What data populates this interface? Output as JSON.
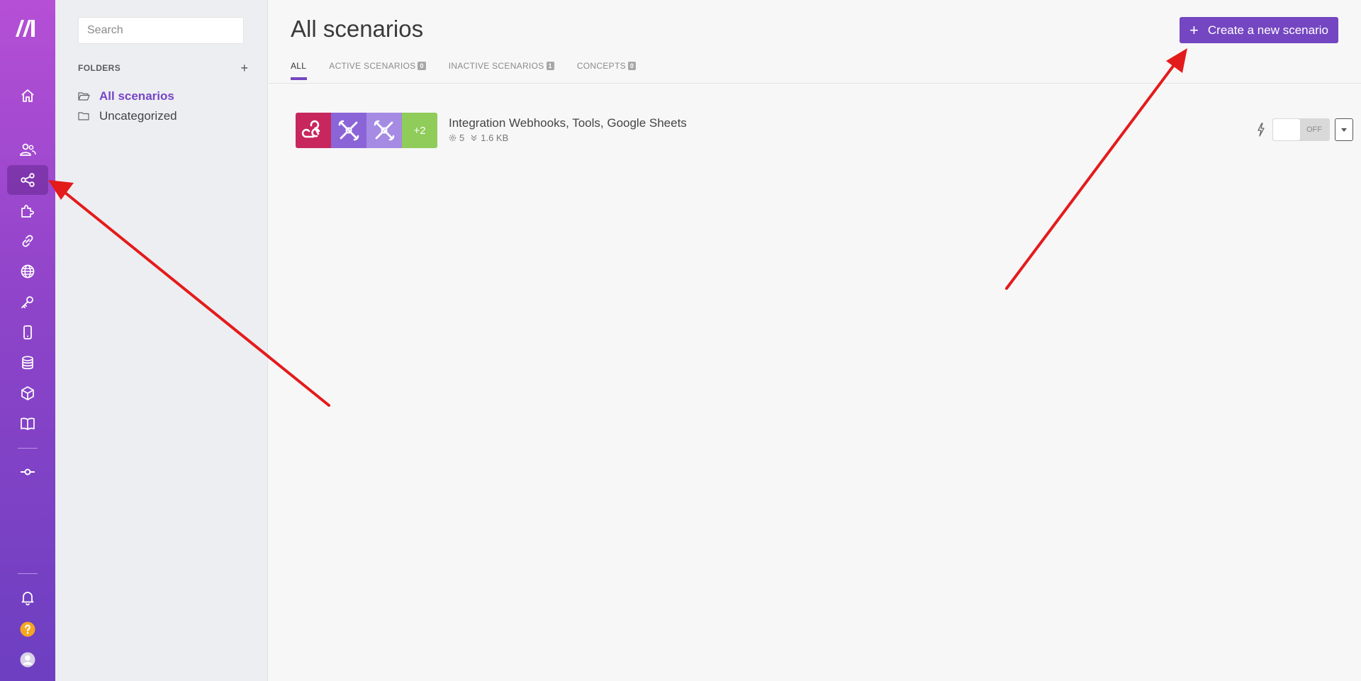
{
  "nav": {
    "items": [
      {
        "icon": "home-icon",
        "active": false
      },
      {
        "icon": "team-icon",
        "active": false
      },
      {
        "icon": "share-nodes-icon",
        "active": true
      },
      {
        "icon": "puzzle-icon",
        "active": false
      },
      {
        "icon": "link-icon",
        "active": false
      },
      {
        "icon": "globe-icon",
        "active": false
      },
      {
        "icon": "key-icon",
        "active": false
      },
      {
        "icon": "mobile-icon",
        "active": false
      },
      {
        "icon": "database-icon",
        "active": false
      },
      {
        "icon": "cube-icon",
        "active": false
      },
      {
        "icon": "book-icon",
        "active": false
      },
      {
        "icon": "commit-icon",
        "active": false
      }
    ],
    "bottom": [
      {
        "icon": "bell-icon"
      },
      {
        "icon": "help-icon"
      },
      {
        "icon": "avatar-icon"
      }
    ]
  },
  "sidebar": {
    "search_placeholder": "Search",
    "folders_title": "FOLDERS",
    "add_folder": "+",
    "folders": [
      {
        "label": "All scenarios",
        "active": true
      },
      {
        "label": "Uncategorized",
        "active": false
      }
    ]
  },
  "header": {
    "title": "All scenarios",
    "create_plus": "+",
    "create_label": "Create a new scenario"
  },
  "tabs": [
    {
      "label": "ALL",
      "count": null,
      "active": true
    },
    {
      "label": "ACTIVE SCENARIOS",
      "count": "0",
      "active": false
    },
    {
      "label": "INACTIVE SCENARIOS",
      "count": "1",
      "active": false
    },
    {
      "label": "CONCEPTS",
      "count": "0",
      "active": false
    }
  ],
  "scenario": {
    "name": "Integration Webhooks, Tools, Google Sheets",
    "operations": "5",
    "data_size": "1.6 KB",
    "more_apps": "+2",
    "toggle_state": "OFF",
    "apps": [
      {
        "icon": "webhooks-icon",
        "color": "#c7275d"
      },
      {
        "icon": "tools-icon",
        "color": "#8b64d8"
      },
      {
        "icon": "tools-icon",
        "color": "#a58be4"
      }
    ],
    "more_color": "#8fcc5a"
  },
  "colors": {
    "accent": "#7446c1",
    "arrow": "#e41b1b"
  }
}
